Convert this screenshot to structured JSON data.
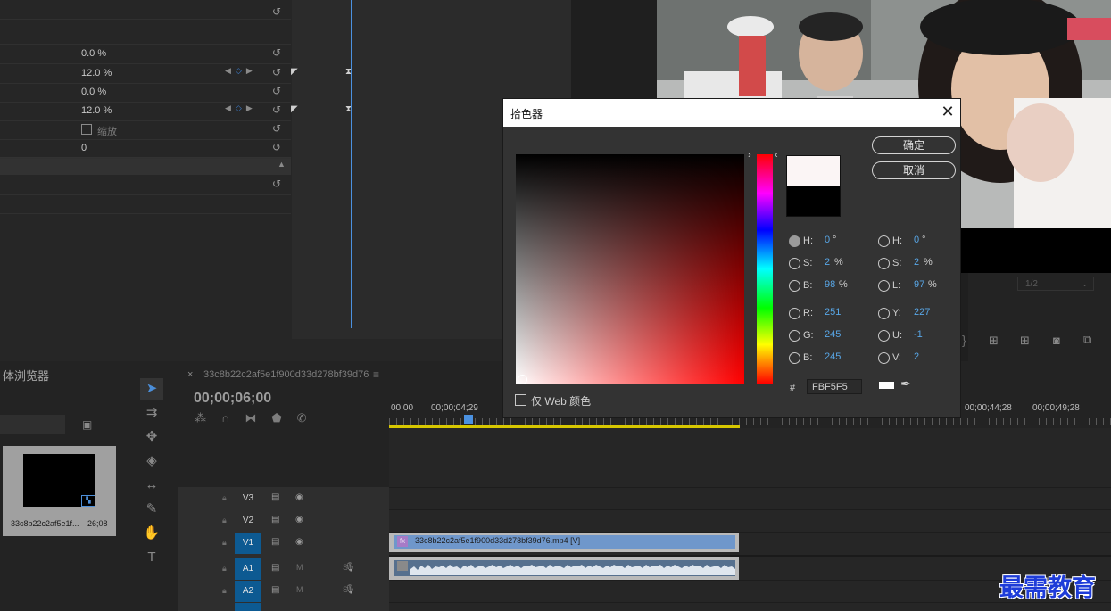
{
  "effect_controls": {
    "rows": [
      {
        "value": ""
      },
      {
        "value": ""
      },
      {
        "value": "0.0 %"
      },
      {
        "value": "12.0 %"
      },
      {
        "value": "0.0 %"
      },
      {
        "value": "12.0 %"
      },
      {
        "value": "缩放"
      },
      {
        "value": "0"
      }
    ]
  },
  "program_monitor": {
    "resolution": "1/2"
  },
  "project": {
    "title": "体浏览器",
    "item_name": "33c8b22c2af5e1f...",
    "item_duration": "26;08"
  },
  "sequence": {
    "tab_close": "×",
    "tab_name": "33c8b22c2af5e1f900d33d278bf39d76",
    "menu": "≡",
    "timecode": "00;00;06;00",
    "ruler_labels": [
      "00;00",
      "00;00;04;29",
      "00;00;44;28",
      "00;00;49;28"
    ],
    "tracks": [
      {
        "name": "V3",
        "active": false
      },
      {
        "name": "V2",
        "active": false
      },
      {
        "name": "V1",
        "active": true
      },
      {
        "name": "A1",
        "active": true
      },
      {
        "name": "A2",
        "active": true
      }
    ],
    "audio_buttons": "M S",
    "clip_video_label": "33c8b22c2af5e1f900d33d278bf39d76.mp4 [V]",
    "clip_fx": "fx"
  },
  "color_picker": {
    "title": "拾色器",
    "ok_label": "确定",
    "cancel_label": "取消",
    "web_colors_label": "仅 Web 颜色",
    "hex": "FBF5F5",
    "new_color": "#FBF5F5",
    "old_color": "#000000",
    "hsb": [
      {
        "label": "H:",
        "value": "0",
        "unit": "°",
        "selected": true
      },
      {
        "label": "S:",
        "value": "2",
        "unit": "%",
        "selected": false
      },
      {
        "label": "B:",
        "value": "98",
        "unit": "%",
        "selected": false
      }
    ],
    "rgb": [
      {
        "label": "R:",
        "value": "251"
      },
      {
        "label": "G:",
        "value": "245"
      },
      {
        "label": "B:",
        "value": "245"
      }
    ],
    "hsl": [
      {
        "label": "H:",
        "value": "0",
        "unit": "°"
      },
      {
        "label": "S:",
        "value": "2",
        "unit": "%"
      },
      {
        "label": "L:",
        "value": "97",
        "unit": "%"
      }
    ],
    "yuv": [
      {
        "label": "Y:",
        "value": "227"
      },
      {
        "label": "U:",
        "value": "-1"
      },
      {
        "label": "V:",
        "value": "2"
      }
    ]
  },
  "watermark": "最需教育",
  "colors": {
    "accent": "#4b91e0",
    "value_blue": "#58a6e6",
    "work_area": "#d7c700"
  }
}
